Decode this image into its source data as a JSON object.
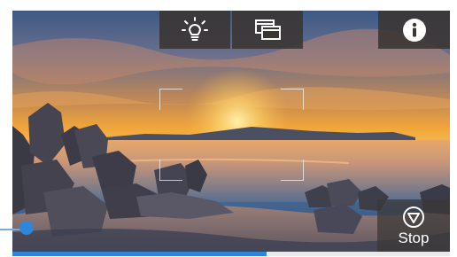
{
  "toolbar": {
    "light_icon": "lightbulb-icon",
    "windows_icon": "overlapping-windows-icon",
    "info_icon": "info-icon"
  },
  "stop": {
    "label": "Stop",
    "icon": "stop-triangle-icon"
  },
  "progress": {
    "value": 0.58
  },
  "colors": {
    "accent": "#2f86d8",
    "toolbar_bg": "#3a3432",
    "icon": "#ffffff"
  }
}
